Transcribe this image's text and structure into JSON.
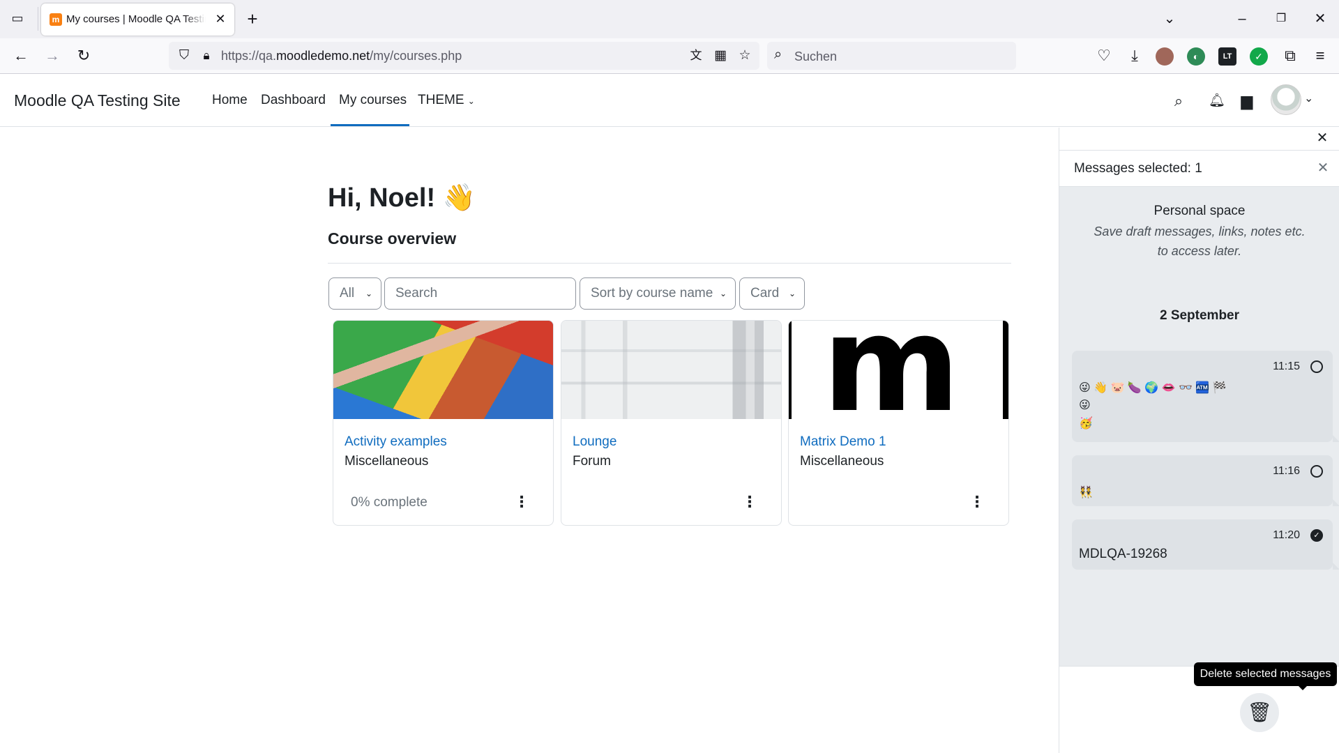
{
  "browser": {
    "tab_title": "My courses | Moodle QA Testing Site",
    "url_prefix": "https://qa.",
    "url_domain": "moodledemo.net",
    "url_path": "/my/courses.php",
    "search_placeholder": "Suchen"
  },
  "header": {
    "site_name": "Moodle QA Testing Site",
    "nav": [
      "Home",
      "Dashboard",
      "My courses",
      "THEME"
    ],
    "active_nav": "My courses"
  },
  "main": {
    "greeting": "Hi, Noel! 👋",
    "section_title": "Course overview",
    "filter": "All",
    "search_placeholder": "Search",
    "sort": "Sort by course name",
    "view": "Card",
    "courses": [
      {
        "name": "Activity examples",
        "category": "Miscellaneous",
        "progress": "0% complete",
        "progress_value": 0
      },
      {
        "name": "Lounge",
        "category": "Forum"
      },
      {
        "name": "Matrix Demo 1",
        "category": "Miscellaneous",
        "image_letter": "m"
      }
    ]
  },
  "drawer": {
    "selected_label": "Messages selected: 1",
    "personal_space_title": "Personal space",
    "personal_space_desc": "Save draft messages, links, notes etc. to access later.",
    "date_heading": "2 September",
    "messages": [
      {
        "time": "11:15",
        "lines": [
          "😜 👋 🐷 🍆 🌍 👄 👓 🏧 🏁",
          "😜",
          "🥳"
        ],
        "selected": false
      },
      {
        "time": "11:16",
        "lines": [
          "👯"
        ],
        "selected": false
      },
      {
        "time": "11:20",
        "text": "MDLQA-19268",
        "selected": true
      }
    ],
    "delete_tooltip": "Delete selected messages"
  },
  "colors": {
    "link": "#0f6cbf",
    "brand_accent": "#0f6cbf",
    "drawer_bg": "#e9ecef"
  },
  "icons": [
    "tab-list-icon",
    "close-icon",
    "plus-icon",
    "minimize-icon",
    "restore-icon",
    "back-icon",
    "forward-icon",
    "reload-icon",
    "shield-icon",
    "lock-icon",
    "translate-icon",
    "qr-icon",
    "star-icon",
    "search-icon",
    "pocket-icon",
    "download-icon",
    "bell-icon",
    "chat-icon",
    "trash-icon",
    "check-icon",
    "kebab-icon"
  ]
}
